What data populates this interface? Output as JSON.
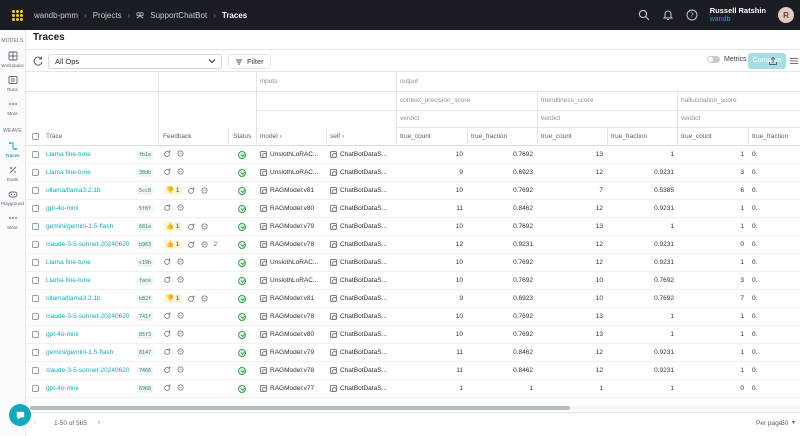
{
  "header": {
    "breadcrumbs": [
      "wandb-pmm",
      "Projects",
      "SupportChatBot",
      "Traces"
    ],
    "user_name": "Russell Ratshin",
    "user_org": "wandb",
    "avatar_initial": "R"
  },
  "sidebar": {
    "section_models": "MODELS",
    "models_items": [
      "Workspace",
      "Runs",
      "More"
    ],
    "section_weave": "WEAVE",
    "weave_items": [
      "Traces",
      "Evals",
      "Playground",
      "More"
    ]
  },
  "page": {
    "title": "Traces"
  },
  "toolbar": {
    "ops_value": "All Ops",
    "filter_label": "Filter",
    "metrics_label": "Metrics",
    "compare_label": "Compare"
  },
  "columns": {
    "group_inputs": "inputs",
    "group_output": "output",
    "sub_context": "context_precision_score",
    "sub_friendliness": "friendliness_score",
    "sub_hallucination": "hallucination_score",
    "verdict": "verdict",
    "trace": "Trace",
    "feedback": "Feedback",
    "status": "Status",
    "model": "model",
    "self": "self",
    "true_count": "true_count",
    "true_fraction": "true_fraction"
  },
  "rows": [
    {
      "trace": "Llama fine-tune",
      "hash": "fb1e",
      "feedback": [],
      "model": "UnslothLoRAC...",
      "self": "ChatBotDataS...",
      "c": [
        10,
        "0.7692",
        13,
        1,
        1,
        "0."
      ]
    },
    {
      "trace": "Llama fine-tune",
      "hash": "38db",
      "feedback": [],
      "model": "UnslothLoRAC...",
      "self": "ChatBotDataS...",
      "c": [
        9,
        "0.6923",
        12,
        "0.9231",
        3,
        "0."
      ]
    },
    {
      "trace": "ollama/llama3.2:1b",
      "hash": "5cc8",
      "feedback": [
        "👎",
        "1"
      ],
      "model": "RAGModel:v81",
      "self": "ChatBotDataS...",
      "c": [
        10,
        "0.7692",
        7,
        "0.5385",
        6,
        "0."
      ]
    },
    {
      "trace": "gpt-4o-mini",
      "hash": "5f8f",
      "feedback": [],
      "model": "RAGModel:v80",
      "self": "ChatBotDataS...",
      "c": [
        11,
        "0.8462",
        12,
        "0.9231",
        1,
        "0."
      ]
    },
    {
      "trace": "gemini/gemini-1.5-flash",
      "hash": "681a",
      "feedback": [
        "👍",
        "1"
      ],
      "model": "RAGModel:v79",
      "self": "ChatBotDataS...",
      "c": [
        10,
        "0.7692",
        13,
        1,
        1,
        "0."
      ]
    },
    {
      "trace": "claude-3-5-sonnet-20240620",
      "hash": "b963",
      "feedback": [
        "👍",
        "1",
        "2"
      ],
      "model": "RAGModel:v78",
      "self": "ChatBotDataS...",
      "c": [
        12,
        "0.9231",
        12,
        "0.9231",
        0,
        "0."
      ]
    },
    {
      "trace": "Llama fine-tune",
      "hash": "c19b",
      "feedback": [],
      "model": "UnslothLoRAC...",
      "self": "ChatBotDataS...",
      "c": [
        10,
        "0.7692",
        12,
        "0.9231",
        1,
        "0."
      ]
    },
    {
      "trace": "Llama fine-tune",
      "hash": "face",
      "feedback": [],
      "model": "UnslothLoRAC...",
      "self": "ChatBotDataS...",
      "c": [
        10,
        "0.7692",
        10,
        "0.7692",
        3,
        "0."
      ]
    },
    {
      "trace": "ollama/llama3.2:1b",
      "hash": "b82f",
      "feedback": [
        "👎",
        "1"
      ],
      "model": "RAGModel:v81",
      "self": "ChatBotDataS...",
      "c": [
        9,
        "0.6923",
        10,
        "0.7692",
        7,
        "0."
      ]
    },
    {
      "trace": "claude-3-5-sonnet-20240620",
      "hash": "741f",
      "feedback": [],
      "model": "RAGModel:v78",
      "self": "ChatBotDataS...",
      "c": [
        10,
        "0.7692",
        13,
        1,
        1,
        "0."
      ]
    },
    {
      "trace": "gpt-4o-mini",
      "hash": "85f3",
      "feedback": [],
      "model": "RAGModel:v80",
      "self": "ChatBotDataS...",
      "c": [
        10,
        "0.7692",
        13,
        1,
        1,
        "0."
      ]
    },
    {
      "trace": "gemini/gemini-1.5-flash",
      "hash": "8147",
      "feedback": [],
      "model": "RAGModel:v79",
      "self": "ChatBotDataS...",
      "c": [
        11,
        "0.8462",
        12,
        "0.9231",
        1,
        "0."
      ]
    },
    {
      "trace": "claude-3-5-sonnet-20240620",
      "hash": "7466",
      "feedback": [],
      "model": "RAGModel:v78",
      "self": "ChatBotDataS...",
      "c": [
        11,
        "0.8462",
        12,
        "0.9231",
        1,
        "0."
      ]
    },
    {
      "trace": "gpt-4o-mini",
      "hash": "6968",
      "feedback": [],
      "model": "RAGModel:v77",
      "self": "ChatBotDataS...",
      "c": [
        1,
        1,
        1,
        1,
        0,
        "0."
      ]
    }
  ],
  "footer": {
    "range": "1-50 of 565",
    "per_page_label": "Per page:",
    "per_page_value": "50"
  }
}
